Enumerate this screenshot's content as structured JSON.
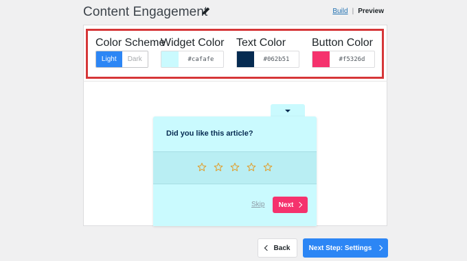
{
  "header": {
    "title": "Content Engagement",
    "build_link": "Build",
    "separator": "|",
    "preview_link": "Preview"
  },
  "settings": {
    "color_scheme": {
      "label": "Color Scheme",
      "options": [
        "Light",
        "Dark"
      ],
      "selected": "Light"
    },
    "widget_color": {
      "label": "Widget Color",
      "value": "#cafafe"
    },
    "text_color": {
      "label": "Text Color",
      "value": "#062b51"
    },
    "button_color": {
      "label": "Button Color",
      "value": "#f5326d"
    }
  },
  "preview": {
    "question": "Did you like this article?",
    "star_count": 5,
    "skip_label": "Skip",
    "next_label": "Next"
  },
  "footer": {
    "back_label": "Back",
    "next_step_label": "Next Step: Settings"
  },
  "colors": {
    "accent": "#2c86f5",
    "highlight_border": "#d63638",
    "widget": "#cafafe",
    "text": "#062b51",
    "button": "#f5326d",
    "star": "#e0a030"
  },
  "icons": {
    "edit": "pencil-icon",
    "tab_toggle": "caret-down-icon",
    "rating": "star-outline-icon",
    "next": "chevron-right-icon",
    "back": "chevron-left-icon"
  }
}
